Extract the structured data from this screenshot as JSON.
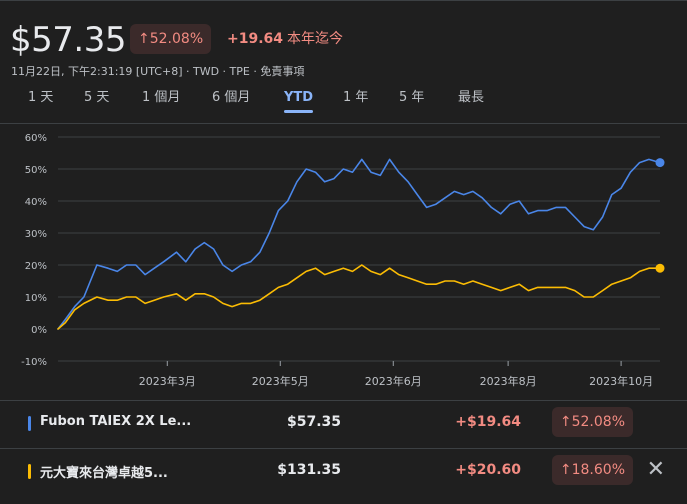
{
  "header": {
    "price": "$57.35",
    "pct_change": "52.08%",
    "abs_change": "+19.64",
    "period_label": "本年迄今",
    "meta": "11月22日, 下午2:31:19 [UTC+8] · TWD · TPE · 免責事項"
  },
  "tabs": [
    {
      "label": "1 天"
    },
    {
      "label": "5 天"
    },
    {
      "label": "1 個月"
    },
    {
      "label": "6 個月"
    },
    {
      "label": "YTD"
    },
    {
      "label": "1 年"
    },
    {
      "label": "5 年"
    },
    {
      "label": "最長"
    }
  ],
  "active_tab": "YTD",
  "comparisons": [
    {
      "name": "Fubon TAIEX 2X Le...",
      "price": "$57.35",
      "change": "+$19.64",
      "pct": "52.08%",
      "color": "#4a86e8"
    },
    {
      "name": "元大寶來台灣卓越5...",
      "price": "$131.35",
      "change": "+$20.60",
      "pct": "18.60%",
      "color": "#fbbc04"
    }
  ],
  "icons": {
    "up_arrow": "arrow-up-icon",
    "close": "close-icon"
  },
  "colors": {
    "positive": "#f28b82",
    "accent": "#8ab4f8",
    "series1": "#4a86e8",
    "series2": "#fbbc04",
    "background": "#1f1f1f"
  },
  "chart_data": {
    "type": "line",
    "ylim": [
      -10,
      60
    ],
    "yticks": [
      60,
      50,
      40,
      30,
      20,
      10,
      0,
      -10
    ],
    "ytick_labels": [
      "60%",
      "50%",
      "40%",
      "30%",
      "20%",
      "10%",
      "0%",
      "-10%"
    ],
    "x_range": [
      1,
      326
    ],
    "xticks": [
      {
        "x": 60,
        "label": "2023年3月"
      },
      {
        "x": 121,
        "label": "2023年5月"
      },
      {
        "x": 182,
        "label": "2023年6月"
      },
      {
        "x": 244,
        "label": "2023年8月"
      },
      {
        "x": 305,
        "label": "2023年10月"
      }
    ],
    "series": [
      {
        "name": "Fubon TAIEX 2X Le...",
        "color": "#4a86e8",
        "x": [
          1,
          5,
          10,
          15,
          22,
          28,
          33,
          38,
          43,
          48,
          53,
          58,
          65,
          70,
          75,
          80,
          85,
          90,
          95,
          100,
          105,
          110,
          115,
          120,
          125,
          130,
          135,
          140,
          145,
          150,
          155,
          160,
          165,
          170,
          175,
          180,
          185,
          190,
          195,
          200,
          205,
          210,
          215,
          220,
          225,
          230,
          235,
          240,
          245,
          250,
          255,
          260,
          265,
          270,
          275,
          280,
          285,
          290,
          295,
          300,
          305,
          310,
          315,
          320,
          326
        ],
        "y": [
          0,
          3,
          7,
          10,
          20,
          19,
          18,
          20,
          20,
          17,
          19,
          21,
          24,
          21,
          25,
          27,
          25,
          20,
          18,
          20,
          21,
          24,
          30,
          37,
          40,
          46,
          50,
          49,
          46,
          47,
          50,
          49,
          53,
          49,
          48,
          53,
          49,
          46,
          42,
          38,
          39,
          41,
          43,
          42,
          43,
          41,
          38,
          36,
          39,
          40,
          36,
          37,
          37,
          38,
          38,
          35,
          32,
          31,
          35,
          42,
          44,
          49,
          52,
          53,
          52
        ]
      },
      {
        "name": "元大寶來台灣卓越5...",
        "color": "#fbbc04",
        "x": [
          1,
          5,
          10,
          15,
          22,
          28,
          33,
          38,
          43,
          48,
          53,
          58,
          65,
          70,
          75,
          80,
          85,
          90,
          95,
          100,
          105,
          110,
          115,
          120,
          125,
          130,
          135,
          140,
          145,
          150,
          155,
          160,
          165,
          170,
          175,
          180,
          185,
          190,
          195,
          200,
          205,
          210,
          215,
          220,
          225,
          230,
          235,
          240,
          245,
          250,
          255,
          260,
          265,
          270,
          275,
          280,
          285,
          290,
          295,
          300,
          305,
          310,
          315,
          320,
          326
        ],
        "y": [
          0,
          2,
          6,
          8,
          10,
          9,
          9,
          10,
          10,
          8,
          9,
          10,
          11,
          9,
          11,
          11,
          10,
          8,
          7,
          8,
          8,
          9,
          11,
          13,
          14,
          16,
          18,
          19,
          17,
          18,
          19,
          18,
          20,
          18,
          17,
          19,
          17,
          16,
          15,
          14,
          14,
          15,
          15,
          14,
          15,
          14,
          13,
          12,
          13,
          14,
          12,
          13,
          13,
          13,
          13,
          12,
          10,
          10,
          12,
          14,
          15,
          16,
          18,
          19,
          19
        ]
      }
    ]
  }
}
